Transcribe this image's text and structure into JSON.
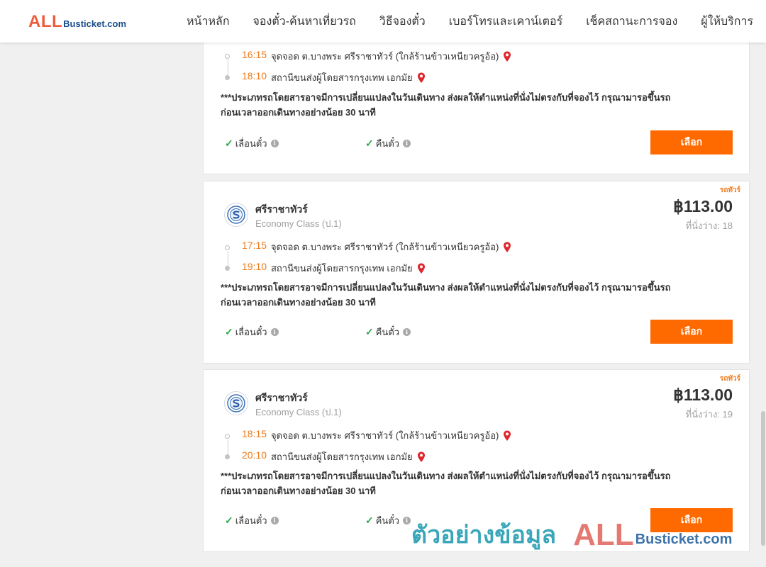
{
  "header": {
    "logo_all": "ALL",
    "logo_rest": "Busticket.com",
    "nav": [
      {
        "label": "หน้าหลัก"
      },
      {
        "label": "จองตั๋ว-ค้นหาเที่ยวรถ"
      },
      {
        "label": "วิธีจองตั๋ว"
      },
      {
        "label": "เบอร์โทรและเคาน์เตอร์"
      },
      {
        "label": "เช็คสถานะการจอง"
      },
      {
        "label": "ผู้ให้บริการ"
      }
    ]
  },
  "trips": [
    {
      "depart_time": "16:15",
      "depart_place": "จุดจอด ต.บางพระ ศรีราชาทัวร์ (ใกล้ร้านข้าวเหนียวครูอ้อ)",
      "arrive_time": "18:10",
      "arrive_place": "สถานีขนส่งผู้โดยสารกรุงเทพ เอกมัย",
      "notice_line1": "***ประเภทรถโดยสารอาจมีการเปลี่ยนแปลงในวันเดินทาง ส่งผลให้ตำแหน่งที่นั่งไม่ตรงกับที่จองไว้ กรุณามารอขึ้นรถ",
      "notice_line2": "ก่อนเวลาออกเดินทางอย่างน้อย 30 นาที",
      "postpone_label": "เลื่อนตั๋ว",
      "refund_label": "คืนตั๋ว",
      "select_label": "เลือก"
    },
    {
      "type_label": "รถทัวร์",
      "operator": "ศรีราชาทัวร์",
      "bus_class": "Economy Class (ป.1)",
      "price": "฿113.00",
      "seats": "ที่นั่งว่าง: 18",
      "depart_time": "17:15",
      "depart_place": "จุดจอด ต.บางพระ ศรีราชาทัวร์ (ใกล้ร้านข้าวเหนียวครูอ้อ)",
      "arrive_time": "19:10",
      "arrive_place": "สถานีขนส่งผู้โดยสารกรุงเทพ เอกมัย",
      "notice_line1": "***ประเภทรถโดยสารอาจมีการเปลี่ยนแปลงในวันเดินทาง ส่งผลให้ตำแหน่งที่นั่งไม่ตรงกับที่จองไว้ กรุณามารอขึ้นรถ",
      "notice_line2": "ก่อนเวลาออกเดินทางอย่างน้อย 30 นาที",
      "postpone_label": "เลื่อนตั๋ว",
      "refund_label": "คืนตั๋ว",
      "select_label": "เลือก"
    },
    {
      "type_label": "รถทัวร์",
      "operator": "ศรีราชาทัวร์",
      "bus_class": "Economy Class (ป.1)",
      "price": "฿113.00",
      "seats": "ที่นั่งว่าง: 19",
      "depart_time": "18:15",
      "depart_place": "จุดจอด ต.บางพระ ศรีราชาทัวร์ (ใกล้ร้านข้าวเหนียวครูอ้อ)",
      "arrive_time": "20:10",
      "arrive_place": "สถานีขนส่งผู้โดยสารกรุงเทพ เอกมัย",
      "notice_line1": "***ประเภทรถโดยสารอาจมีการเปลี่ยนแปลงในวันเดินทาง ส่งผลให้ตำแหน่งที่นั่งไม่ตรงกับที่จองไว้ กรุณามารอขึ้นรถ",
      "notice_line2": "ก่อนเวลาออกเดินทางอย่างน้อย 30 นาที",
      "postpone_label": "เลื่อนตั๋ว",
      "refund_label": "คืนตั๋ว",
      "select_label": "เลือก"
    }
  ],
  "icons": {
    "check": "check-icon",
    "info": "info-icon",
    "pin": "map-pin-icon"
  },
  "colors": {
    "accent": "#ff6a00",
    "time": "#f07a1a",
    "check": "#2ea84a",
    "pin": "#e0262c"
  },
  "watermark": {
    "thai": "ตัวอย่างข้อมูล",
    "all": "ALL",
    "rest": "Busticket.com"
  }
}
